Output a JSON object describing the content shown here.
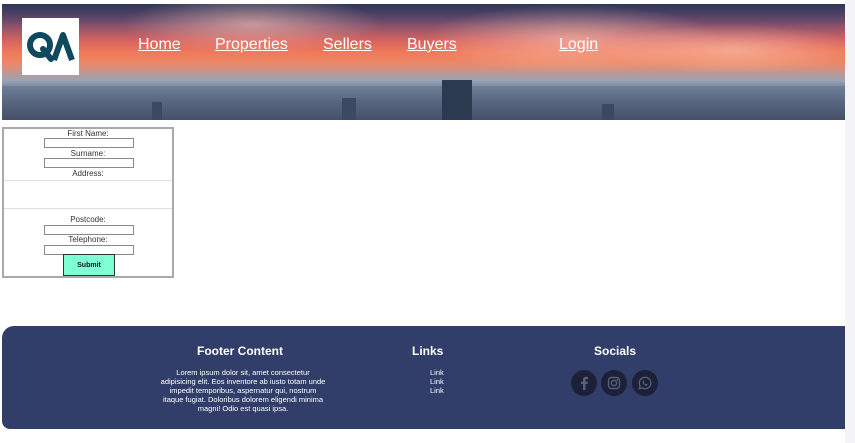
{
  "header": {
    "logo_alt": "QA",
    "nav": [
      {
        "label": "Home"
      },
      {
        "label": "Properties"
      },
      {
        "label": "Sellers"
      },
      {
        "label": "Buyers"
      },
      {
        "label": "Login"
      }
    ]
  },
  "form": {
    "first_name_label": "First Name:",
    "surname_label": "Surname:",
    "address_label": "Address:",
    "postcode_label": "Postcode:",
    "telephone_label": "Telephone:",
    "submit_label": "Submit"
  },
  "footer": {
    "content_title": "Footer Content",
    "content_text": "Lorem ipsum dolor sit, amet consectetur adipisicing elit. Eos inventore ab iusto totam unde impedit temporibus, aspernatur qui, nostrum itaque fugiat. Doloribus dolorem eligendi minima magni! Odio est quasi ipsa.",
    "links_title": "Links",
    "links": [
      "Link",
      "Link",
      "Link"
    ],
    "socials_title": "Socials",
    "socials": [
      "facebook-icon",
      "instagram-icon",
      "whatsapp-icon"
    ]
  },
  "colors": {
    "footer_bg": "#323e6a",
    "submit_bg": "#7fffd4"
  }
}
